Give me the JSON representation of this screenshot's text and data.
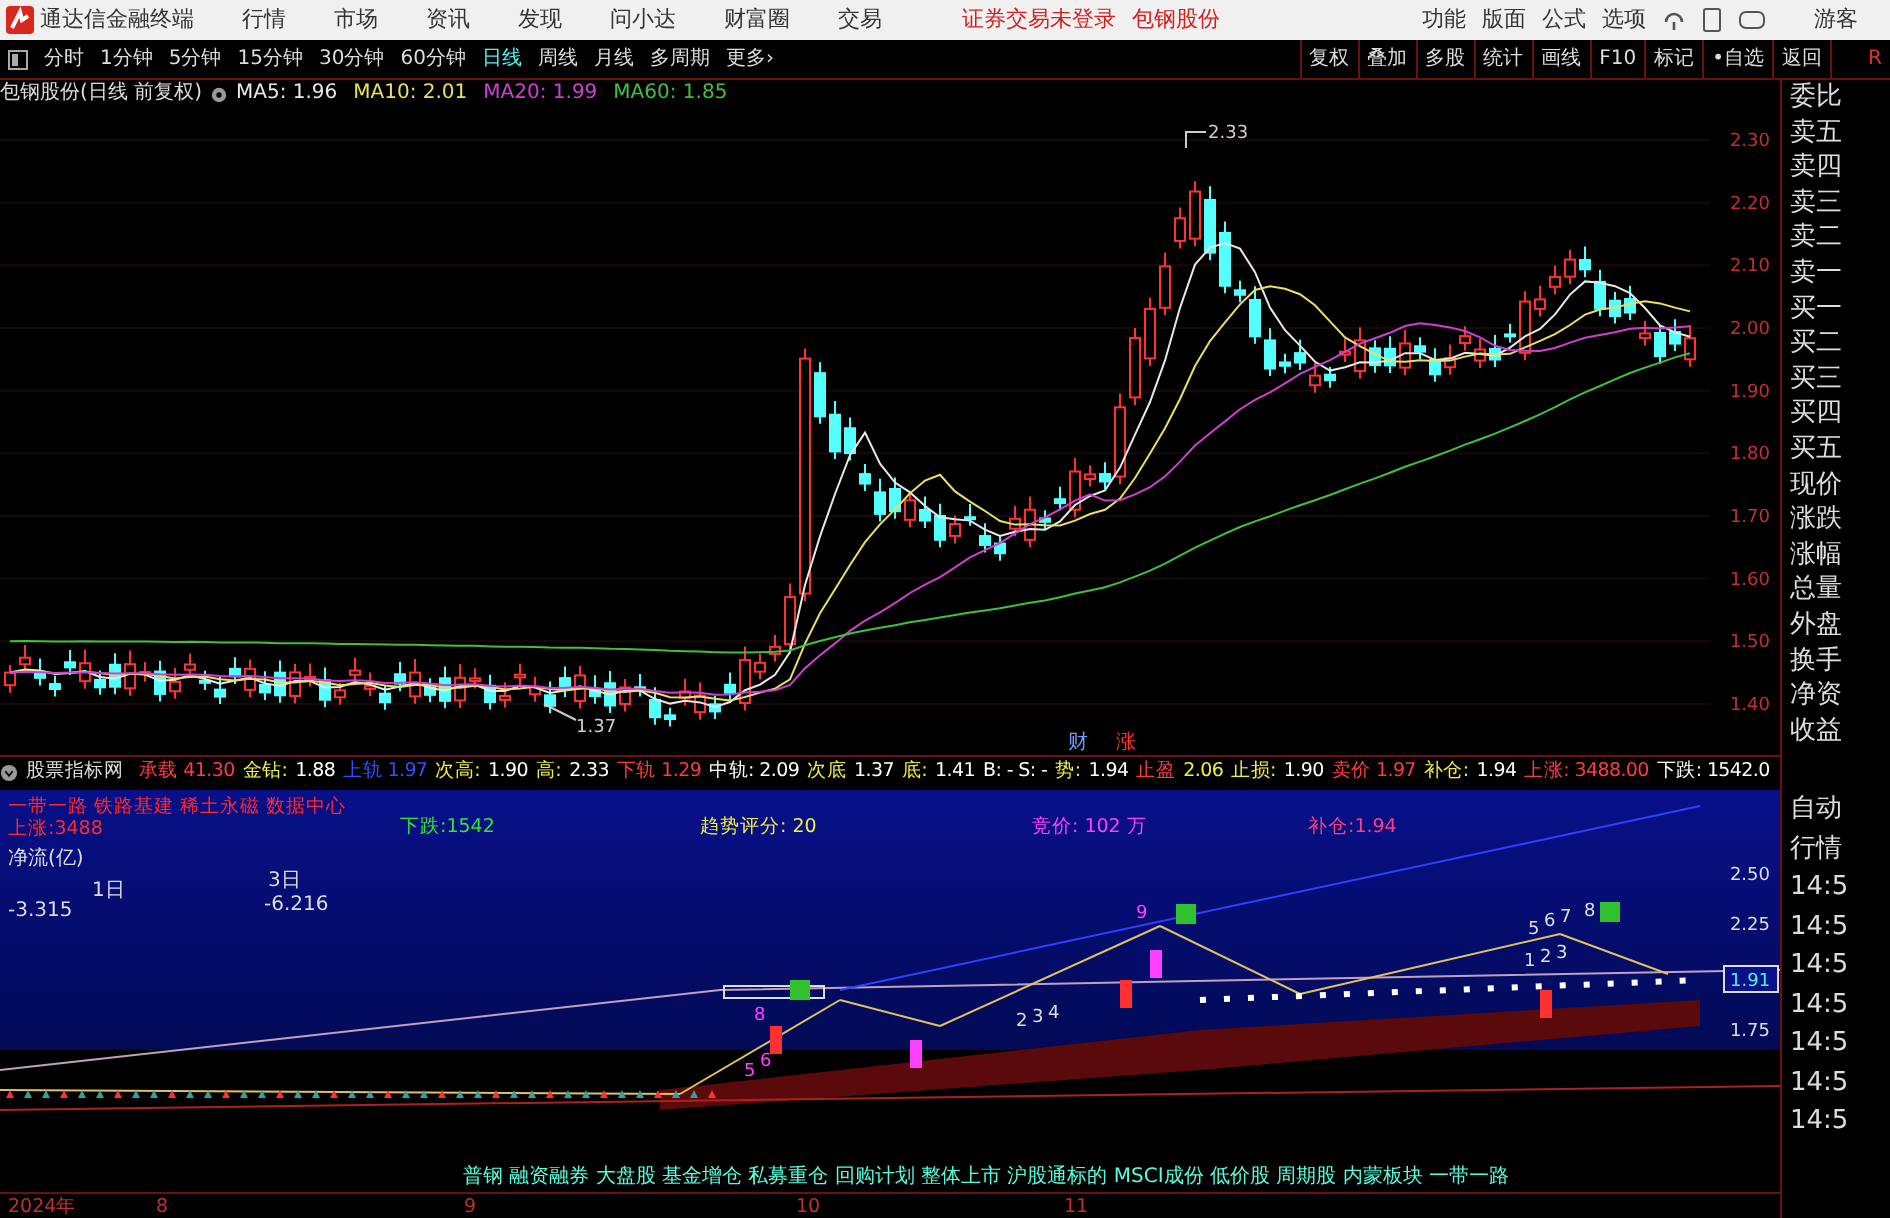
{
  "titlebar": {
    "app_name": "通达信金融终端",
    "menu": [
      "行情",
      "市场",
      "资讯",
      "发现",
      "问小达",
      "财富圈",
      "交易"
    ],
    "notice": "证券交易未登录",
    "stock": "包钢股份",
    "tools": [
      "功能",
      "版面",
      "公式",
      "选项"
    ],
    "user": "游客"
  },
  "toolbar": {
    "periods": [
      {
        "label": "分时",
        "selected": false
      },
      {
        "label": "1分钟",
        "selected": false
      },
      {
        "label": "5分钟",
        "selected": false
      },
      {
        "label": "15分钟",
        "selected": false
      },
      {
        "label": "30分钟",
        "selected": false
      },
      {
        "label": "60分钟",
        "selected": false
      },
      {
        "label": "日线",
        "selected": true
      },
      {
        "label": "周线",
        "selected": false
      },
      {
        "label": "月线",
        "selected": false
      },
      {
        "label": "多周期",
        "selected": false
      },
      {
        "label": "更多›",
        "selected": false
      }
    ],
    "actions": [
      "复权",
      "叠加",
      "多股",
      "统计",
      "画线",
      "F10",
      "标记",
      "•自选",
      "返回"
    ],
    "corner": "R"
  },
  "chart": {
    "title": "包钢股份(日线 前复权)",
    "ma": [
      {
        "label": "MA5: 1.96",
        "color": "#e8e8e8"
      },
      {
        "label": "MA10: 2.01",
        "color": "#e8e060"
      },
      {
        "label": "MA20: 1.99",
        "color": "#d040d0"
      },
      {
        "label": "MA60: 1.85",
        "color": "#40c040"
      }
    ],
    "price_axis": [
      "2.30",
      "2.20",
      "2.10",
      "2.00",
      "1.90",
      "1.80",
      "1.70",
      "1.60",
      "1.50",
      "1.40"
    ],
    "high_label": "2.33",
    "low_label": "1.37",
    "markers": [
      "财",
      "涨"
    ]
  },
  "side_panel": [
    "委比",
    "卖五",
    "卖四",
    "卖三",
    "卖二",
    "卖一",
    "买一",
    "买二",
    "买三",
    "买四",
    "买五",
    "现价",
    "涨跌",
    "涨幅",
    "总量",
    "外盘",
    "换手",
    "净资",
    "收益"
  ],
  "indicator_bar": {
    "name": "股票指标网",
    "items": [
      {
        "text": "承载 41.30",
        "color": "#ff3c3c"
      },
      {
        "text": "金钻:",
        "color": "#f0f040"
      },
      {
        "text": "1.88",
        "color": "#ffffff"
      },
      {
        "text": "上轨 1.97",
        "color": "#3050ff"
      },
      {
        "text": "次高:",
        "color": "#f0f040"
      },
      {
        "text": "1.90",
        "color": "#ffffff"
      },
      {
        "text": "高:",
        "color": "#f0f040"
      },
      {
        "text": "2.33",
        "color": "#ffffff"
      },
      {
        "text": "下轨 1.29",
        "color": "#ff3c3c"
      },
      {
        "text": "中轨: 2.09",
        "color": "#ffffff"
      },
      {
        "text": "次底",
        "color": "#f0f040"
      },
      {
        "text": "1.37",
        "color": "#ffffff"
      },
      {
        "text": "底:",
        "color": "#f0f040"
      },
      {
        "text": "1.41",
        "color": "#ffffff"
      },
      {
        "text": "B: -  S: -",
        "color": "#ffffff"
      },
      {
        "text": "势:",
        "color": "#f0f040"
      },
      {
        "text": "1.94",
        "color": "#ffffff"
      },
      {
        "text": "止盈",
        "color": "#ff3c3c"
      },
      {
        "text": "2.06",
        "color": "#f0f040"
      },
      {
        "text": "止损:",
        "color": "#f0f040"
      },
      {
        "text": "1.90",
        "color": "#ffffff"
      },
      {
        "text": "卖价 1.97",
        "color": "#ff3c3c"
      },
      {
        "text": "补仓:",
        "color": "#f0f040"
      },
      {
        "text": "1.94",
        "color": "#ffffff"
      },
      {
        "text": "上涨: 3488.00",
        "color": "#ff3c3c"
      },
      {
        "text": "下跌: 1542.0",
        "color": "#ffffff"
      }
    ]
  },
  "lower_panel": {
    "texts": [
      {
        "text": "一带一路 铁路基建 稀土永磁 数据中心",
        "color": "#ff2a2a"
      },
      {
        "text": "上涨:3488",
        "color": "#ff2a2a"
      },
      {
        "text": "下跌:1542",
        "color": "#30e830"
      },
      {
        "text": "趋势评分:  20",
        "color": "#f0f040"
      },
      {
        "text": "竞价: 102 万",
        "color": "#ff40ff"
      },
      {
        "text": "补仓:1.94",
        "color": "#ff4080"
      }
    ],
    "flow_title": "净流(亿)",
    "flows": [
      {
        "period": "1日",
        "value": "-3.315"
      },
      {
        "period": "3日",
        "value": "-6.216"
      }
    ],
    "axis": [
      "2.50",
      "2.25",
      "1.75"
    ],
    "current": "1.91",
    "wave_labels": [
      "8",
      "5",
      "6",
      "9",
      "2",
      "3",
      "4",
      "1",
      "2",
      "3",
      "5",
      "6",
      "7",
      "8"
    ]
  },
  "tags": "普钢 融资融券 大盘股 基金增仓 私募重仓 回购计划 整体上市 沪股通标的 MSCI成份 低价股 周期股 内蒙板块 一带一路",
  "date_axis": [
    "2024年",
    "8",
    "9",
    "10",
    "11"
  ],
  "side_column": [
    "自动",
    "行情",
    "14:5",
    "14:5",
    "14:5",
    "14:5",
    "14:5",
    "14:5",
    "14:5"
  ]
}
